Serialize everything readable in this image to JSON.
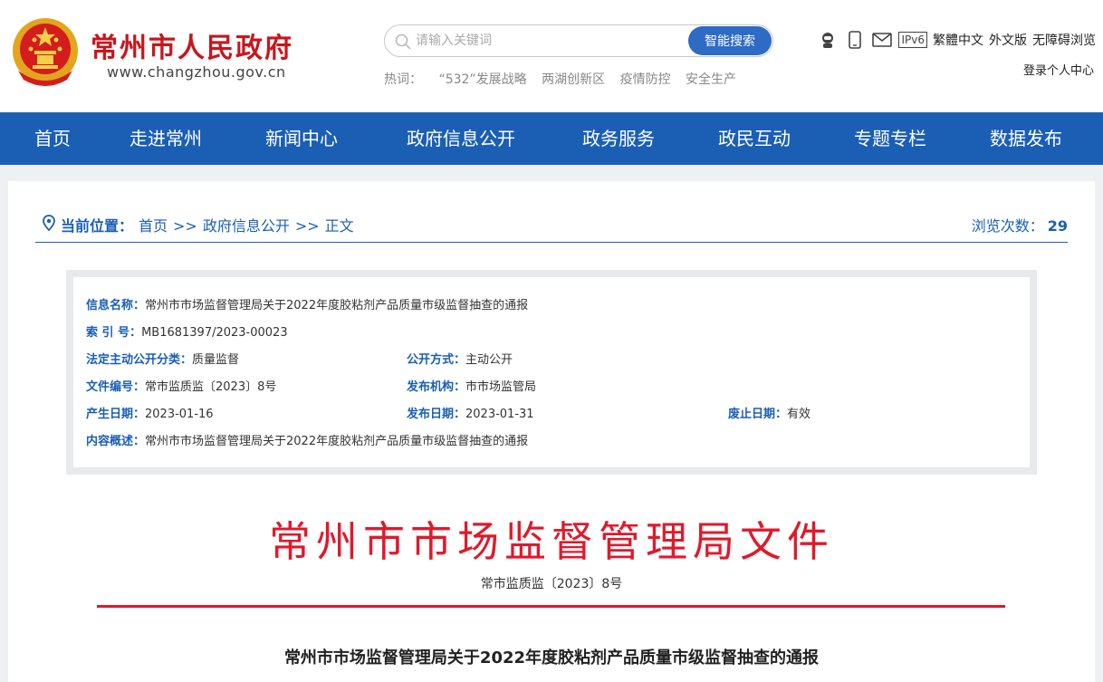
{
  "header": {
    "site_title": "常州市人民政府",
    "site_domain": "www.changzhou.gov.cn",
    "search": {
      "placeholder": "请输入关键词",
      "button_label": "智能搜索"
    },
    "hotwords": {
      "label": "热词：",
      "items": [
        "“532”发展战略",
        "两湖创新区",
        "疫情防控",
        "安全生产"
      ]
    },
    "toolbar": {
      "icons": [
        "robot-icon",
        "mobile-phone-icon",
        "email-icon"
      ],
      "ipv6_label": "IPv6",
      "traditional_label": "繁體中文",
      "foreign_label": "外文版",
      "accessible_label": "无障碍浏览"
    },
    "login_label": "登录个人中心"
  },
  "nav": {
    "items": [
      "首页",
      "走进常州",
      "新闻中心",
      "政府信息公开",
      "政务服务",
      "政民互动",
      "专题专栏",
      "数据发布"
    ]
  },
  "breadcrumb": {
    "label": "当前位置：",
    "items": [
      "首页",
      "政府信息公开",
      "正文"
    ],
    "separator": ">>"
  },
  "views": {
    "label": "浏览次数：",
    "count": "29"
  },
  "info": {
    "name_k": "信息名称：",
    "name_v": "常州市市场监督管理局关于2022年度胶粘剂产品质量市级监督抽查的通报",
    "index_k": "索 引 号：",
    "index_v": "MB1681397/2023-00023",
    "category_k": "法定主动公开分类：",
    "category_v": "质量监督",
    "mode_k": "公开方式：",
    "mode_v": "主动公开",
    "docno_k": "文件编号：",
    "docno_v": "常市监质监〔2023〕8号",
    "org_k": "发布机构：",
    "org_v": "市市场监管局",
    "created_k": "产生日期：",
    "created_v": "2023-01-16",
    "published_k": "发布日期：",
    "published_v": "2023-01-31",
    "expiry_k": "废止日期：",
    "expiry_v": "有效",
    "summary_k": "内容概述：",
    "summary_v": "常州市市场监督管理局关于2022年度胶粘剂产品质量市级监督抽查的通报"
  },
  "document": {
    "red_title": "常州市市场监督管理局文件",
    "number": "常市监质监〔2023〕8号",
    "title": "常州市市场监督管理局关于2022年度胶粘剂产品质量市级监督抽查的通报"
  },
  "colors": {
    "brand_blue": "#1a5fb4",
    "search_blue": "#2d6bc4",
    "red": "#e0192b"
  }
}
